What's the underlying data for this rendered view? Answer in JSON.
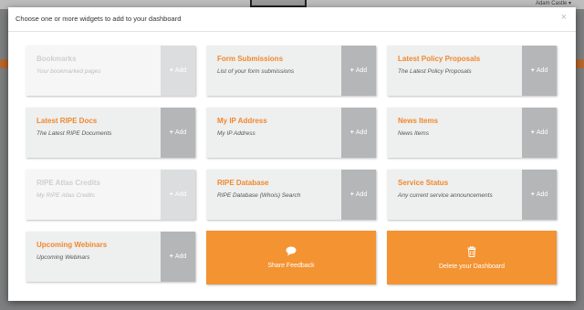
{
  "background": {
    "user_name": "Adam Castle ▾"
  },
  "modal": {
    "title": "Choose one or more widgets to add to your dashboard",
    "close_icon": "×"
  },
  "add_label": "Add",
  "widgets": [
    {
      "title": "Bookmarks",
      "description": "Your bookmarked pages",
      "disabled": true
    },
    {
      "title": "Form Submissions",
      "description": "List of your form submissions",
      "disabled": false
    },
    {
      "title": "Latest Policy Proposals",
      "description": "The Latest Policy Proposals",
      "disabled": false
    },
    {
      "title": "Latest RIPE Docs",
      "description": "The Latest RIPE Documents",
      "disabled": false
    },
    {
      "title": "My IP Address",
      "description": "My IP Address",
      "disabled": false
    },
    {
      "title": "News Items",
      "description": "News Items",
      "disabled": false
    },
    {
      "title": "RIPE Atlas Credits",
      "description": "My RIPE Atlas Credits",
      "disabled": true
    },
    {
      "title": "RIPE Database",
      "description": "RIPE Database (Whois) Search",
      "disabled": false
    },
    {
      "title": "Service Status",
      "description": "Any current service announcements",
      "disabled": false
    },
    {
      "title": "Upcoming Webinars",
      "description": "Upcoming Webinars",
      "disabled": false
    }
  ],
  "actions": {
    "feedback": {
      "label": "Share Feedback",
      "icon": "speech-bubble-icon"
    },
    "delete": {
      "label": "Delete your Dashboard",
      "icon": "trash-icon"
    }
  },
  "colors": {
    "accent": "#f39332",
    "title_orange": "#f0882d",
    "card_bg": "#eeefef",
    "add_bg": "#b4b6b8"
  }
}
